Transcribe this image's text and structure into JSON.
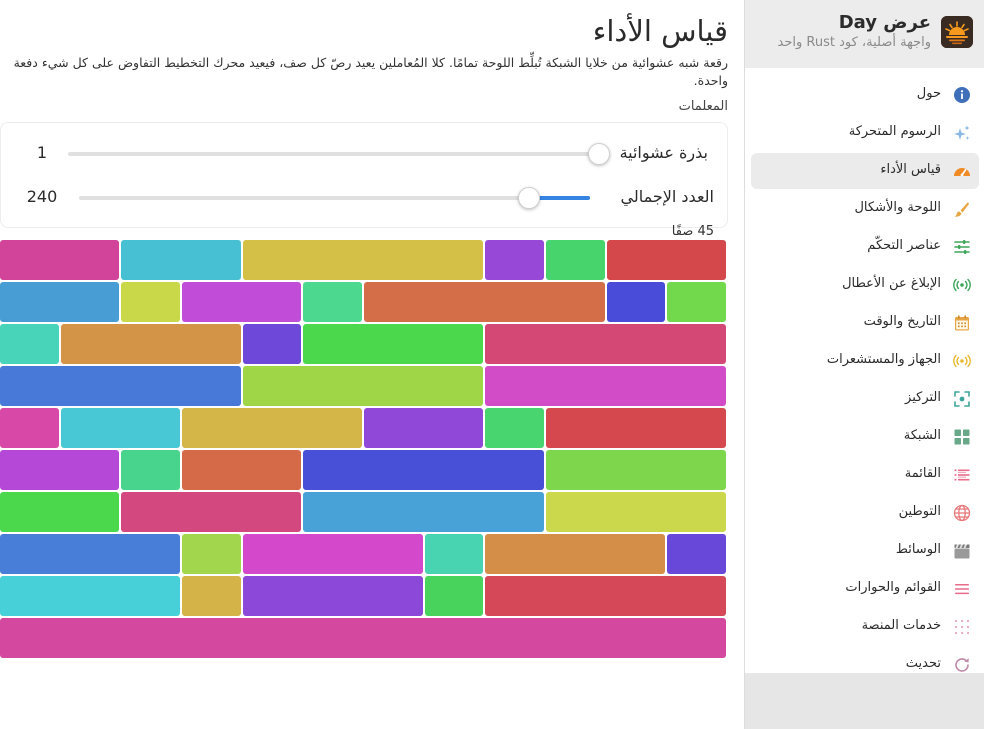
{
  "app": {
    "title": "عرض Day",
    "subtitle": "واجهة أصلية، كود Rust واحد"
  },
  "sidebar": {
    "items": [
      {
        "label": "حول",
        "icon": "info-icon",
        "active": false
      },
      {
        "label": "الرسوم المتحركة",
        "icon": "sparkle-icon",
        "active": false
      },
      {
        "label": "قياس الأداء",
        "icon": "speedometer-icon",
        "active": true
      },
      {
        "label": "اللوحة والأشكال",
        "icon": "brush-icon",
        "active": false
      },
      {
        "label": "عناصر التحكّم",
        "icon": "sliders-icon",
        "active": false
      },
      {
        "label": "الإبلاغ عن الأعطال",
        "icon": "broadcast-icon",
        "active": false
      },
      {
        "label": "التاريخ والوقت",
        "icon": "calendar-icon",
        "active": false
      },
      {
        "label": "الجهاز والمستشعرات",
        "icon": "sensor-icon",
        "active": false
      },
      {
        "label": "التركيز",
        "icon": "focus-icon",
        "active": false
      },
      {
        "label": "الشبكة",
        "icon": "grid-icon",
        "active": false
      },
      {
        "label": "القائمة",
        "icon": "list-icon",
        "active": false
      },
      {
        "label": "التوطين",
        "icon": "globe-icon",
        "active": false
      },
      {
        "label": "الوسائط",
        "icon": "clapperboard-icon",
        "active": false
      },
      {
        "label": "القوائم والحوارات",
        "icon": "menu-icon",
        "active": false
      },
      {
        "label": "خدمات المنصة",
        "icon": "dots-grid-icon",
        "active": false
      },
      {
        "label": "تحديث",
        "icon": "refresh-icon",
        "active": false
      }
    ]
  },
  "main": {
    "title": "قياس الأداء",
    "description": "رقعة شبه عشوائية من خلايا الشبكة تُبلِّط اللوحة تمامًا. كلا المُعاملين يعيد رصّ كل صف، فيعيد محرك التخطيط التفاوض على كل شيء دفعة واحدة.",
    "params_label": "المعلمات",
    "seed": {
      "label": "بذرة عشوائية",
      "value": "1",
      "fraction": 0.0
    },
    "total": {
      "label": "العدد الإجمالي",
      "value": "240",
      "fraction": 0.12
    },
    "row_count": "45 صفًا"
  },
  "colors": {
    "accent": "#3584e4",
    "icon_info": "#3f6fb8",
    "icon_speed": "#f08a24",
    "icon_green": "#3ea55b",
    "icon_orange": "#e8a545",
    "icon_pink": "#e86b8a"
  },
  "grid": {
    "rows": [
      [
        {
          "span": 2,
          "color": "#d2449a"
        },
        {
          "span": 2,
          "color": "#48c0d4"
        },
        {
          "span": 4,
          "color": "#d4c046"
        },
        {
          "span": 1,
          "color": "#9848d6"
        },
        {
          "span": 1,
          "color": "#48d46c"
        },
        {
          "span": 2,
          "color": "#d4484c"
        }
      ],
      [
        {
          "span": 2,
          "color": "#489ed4"
        },
        {
          "span": 1,
          "color": "#c8d848"
        },
        {
          "span": 2,
          "color": "#c04cd8"
        },
        {
          "span": 1,
          "color": "#4cd88e"
        },
        {
          "span": 4,
          "color": "#d46e48"
        },
        {
          "span": 1,
          "color": "#484cd8"
        },
        {
          "span": 1,
          "color": "#72d84c"
        }
      ],
      [
        {
          "span": 1,
          "color": "#48d4b8"
        },
        {
          "span": 3,
          "color": "#d49448"
        },
        {
          "span": 1,
          "color": "#6e48d8"
        },
        {
          "span": 3,
          "color": "#4cd84c"
        },
        {
          "span": 4,
          "color": "#d44876"
        }
      ],
      [
        {
          "span": 4,
          "color": "#4878d8"
        },
        {
          "span": 4,
          "color": "#9ed648"
        },
        {
          "span": 4,
          "color": "#d24cc8"
        }
      ],
      [
        {
          "span": 1,
          "color": "#d848a6"
        },
        {
          "span": 2,
          "color": "#48c8d4"
        },
        {
          "span": 3,
          "color": "#d4b648"
        },
        {
          "span": 2,
          "color": "#9048d8"
        },
        {
          "span": 1,
          "color": "#48d46e"
        },
        {
          "span": 3,
          "color": "#d4484e"
        }
      ],
      [
        {
          "span": 2,
          "color": "#b648d8"
        },
        {
          "span": 1,
          "color": "#48d48c"
        },
        {
          "span": 2,
          "color": "#d46a48"
        },
        {
          "span": 4,
          "color": "#4850d8"
        },
        {
          "span": 3,
          "color": "#7ed64c"
        }
      ],
      [
        {
          "span": 2,
          "color": "#4cd84c"
        },
        {
          "span": 3,
          "color": "#d44880"
        },
        {
          "span": 4,
          "color": "#48a2d8"
        },
        {
          "span": 3,
          "color": "#ccd84c"
        }
      ],
      [
        {
          "span": 3,
          "color": "#487ed8"
        },
        {
          "span": 1,
          "color": "#a2d64c"
        },
        {
          "span": 3,
          "color": "#d448cc"
        },
        {
          "span": 1,
          "color": "#48d4b0"
        },
        {
          "span": 3,
          "color": "#d48e48"
        },
        {
          "span": 1,
          "color": "#6848d8"
        }
      ],
      [
        {
          "span": 3,
          "color": "#48d0d8"
        },
        {
          "span": 1,
          "color": "#d4b448"
        },
        {
          "span": 3,
          "color": "#8c48d8"
        },
        {
          "span": 1,
          "color": "#48d45c"
        },
        {
          "span": 4,
          "color": "#d44858"
        }
      ],
      [
        {
          "span": 12,
          "color": "#d448a0"
        }
      ]
    ]
  }
}
